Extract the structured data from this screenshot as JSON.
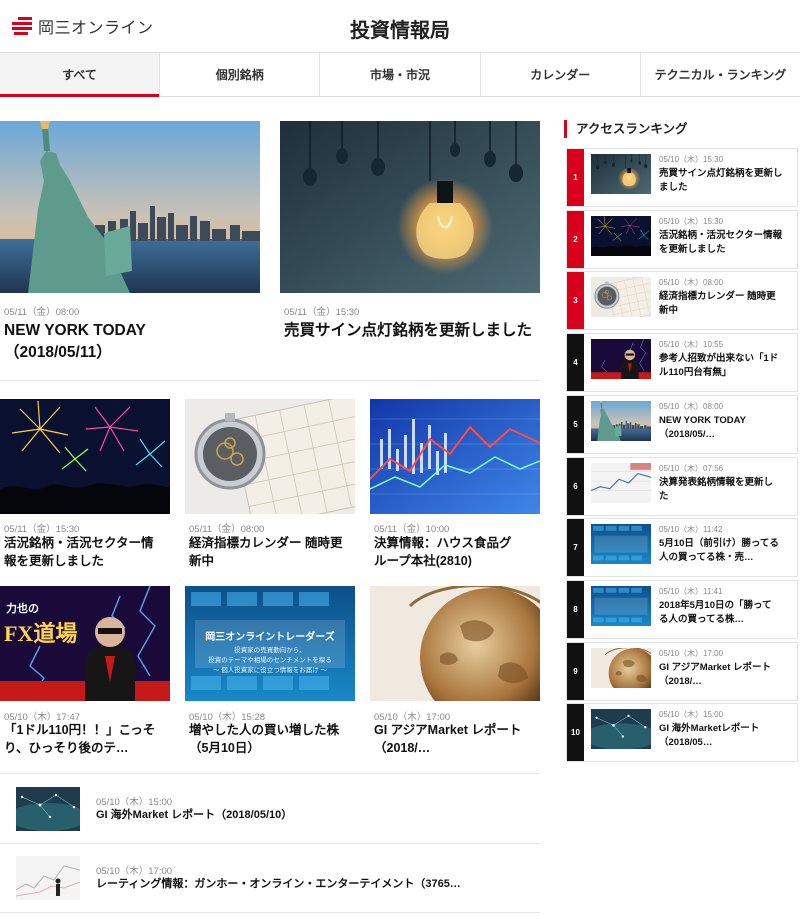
{
  "header": {
    "logo_text": "岡三オンライン",
    "page_title": "投資情報局"
  },
  "tabs": [
    {
      "label": "すべて"
    },
    {
      "label": "個別銘柄"
    },
    {
      "label": "市場・市況"
    },
    {
      "label": "カレンダー"
    },
    {
      "label": "テクニカル・ランキング"
    }
  ],
  "featured": [
    {
      "meta": "05/11（金）08:00",
      "title_line1": "NEW YORK TODAY",
      "title_line2": "（2018/05/11）",
      "thumb": "statue-of-liberty"
    },
    {
      "meta": "05/11（金）15:30",
      "title_line1": "売買サイン点灯銘柄を更新しました",
      "title_line2": "",
      "thumb": "light-bulbs"
    }
  ],
  "grid": [
    {
      "meta": "05/11（金）15:30",
      "title_line1": "活況銘柄・活況セクター情",
      "title_line2": "報を更新しました",
      "thumb": "fireworks"
    },
    {
      "meta": "05/11（金）08:00",
      "title_line1": "経済指標カレンダー 随時更",
      "title_line2": "新中",
      "thumb": "watch-calendar"
    },
    {
      "meta": "05/11（金）10:00",
      "title_line1": "決算情報：ハウス食品グ",
      "title_line2": "ループ本社(2810)",
      "thumb": "blue-chart"
    },
    {
      "meta": "05/10（木）17:47",
      "title_line1": "「1ドル110円！！」こっそ",
      "title_line2": "り、ひっそり後のテ…",
      "thumb": "fx-dojo"
    },
    {
      "meta": "05/10（木）15:28",
      "title_line1": "増やした人の買い増した株",
      "title_line2": "（5月10日）",
      "thumb": "online-traders"
    },
    {
      "meta": "05/10（木）17:00",
      "title_line1": "GI アジアMarket レポート",
      "title_line2": "（2018/…",
      "thumb": "globe"
    }
  ],
  "thumb_text": {
    "fx_line1": "力也の",
    "fx_line2": "FX道場",
    "traders_line1": "岡三オンライントレーダーズ",
    "traders_line2": "投資家の売買動向から、",
    "traders_line3": "投資のテーマや相場のセンチメントを探る",
    "traders_line4": "～ 個人投資家に役立つ情報をお届け ～"
  },
  "list": [
    {
      "meta": "05/10（木）15:00",
      "title": "GI 海外Market レポート（2018/05/10）",
      "thumb": "world-network"
    },
    {
      "meta": "05/10（木）17:00",
      "title": "レーティング情報：ガンホー・オンライン・エンターテイメント（3765…",
      "thumb": "chart-person"
    }
  ],
  "ranking": {
    "heading": "アクセスランキング",
    "items": [
      {
        "rank": "1",
        "meta": "05/10（木）15:30",
        "title_line1": "売買サイン点灯銘柄を更新し",
        "title_line2": "ました",
        "color": "#d9001b",
        "thumb": "light-bulbs"
      },
      {
        "rank": "2",
        "meta": "05/10（木）15:30",
        "title_line1": "活況銘柄・活況セクター情報",
        "title_line2": "を更新しました",
        "color": "#d9001b",
        "thumb": "fireworks"
      },
      {
        "rank": "3",
        "meta": "05/10（木）08:00",
        "title_line1": "経済指標カレンダー 随時更",
        "title_line2": "新中",
        "color": "#d9001b",
        "thumb": "watch-calendar"
      },
      {
        "rank": "4",
        "meta": "05/10（木）10:55",
        "title_line1": "参考人招致が出来ない「1ド",
        "title_line2": "ル110円台有無」",
        "color": "#111111",
        "thumb": "fx-dojo"
      },
      {
        "rank": "5",
        "meta": "05/10（木）08:00",
        "title_line1": "NEW YORK TODAY",
        "title_line2": "（2018/05/…",
        "color": "#111111",
        "thumb": "statue-of-liberty"
      },
      {
        "rank": "6",
        "meta": "05/10（木）07:56",
        "title_line1": "決算発表銘柄情報を更新し",
        "title_line2": "た",
        "color": "#111111",
        "thumb": "paper-chart"
      },
      {
        "rank": "7",
        "meta": "05/10（木）11:42",
        "title_line1": "5月10日（前引け）勝ってる",
        "title_line2": "人の買ってる株・売…",
        "color": "#111111",
        "thumb": "online-traders"
      },
      {
        "rank": "8",
        "meta": "05/10（木）11:41",
        "title_line1": "2018年5月10日の「勝って",
        "title_line2": "る人の買ってる株…",
        "color": "#111111",
        "thumb": "online-traders"
      },
      {
        "rank": "9",
        "meta": "05/10（木）17:00",
        "title_line1": "GI アジアMarket レポート",
        "title_line2": "（2018/…",
        "color": "#111111",
        "thumb": "globe"
      },
      {
        "rank": "10",
        "meta": "05/10（木）15:00",
        "title_line1": "GI 海外Marketレポート",
        "title_line2": "（2018/05…",
        "color": "#111111",
        "thumb": "world-network"
      }
    ]
  }
}
